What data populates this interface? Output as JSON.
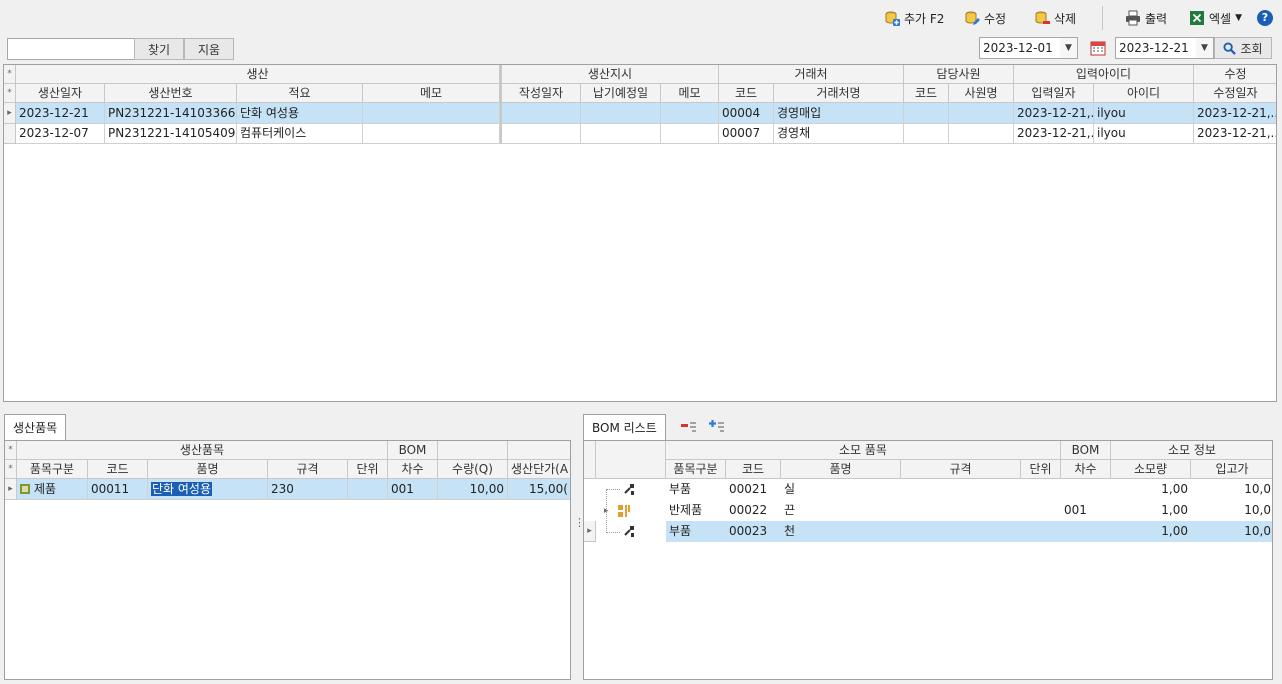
{
  "toolbar": {
    "add_label": "추가 F2",
    "edit_label": "수정",
    "delete_label": "삭제",
    "print_label": "출력",
    "excel_label": "엑셀",
    "help_icon": "?"
  },
  "search": {
    "input_value": "",
    "find_label": "찾기",
    "clear_label": "지움",
    "date_from": "2023-12-01",
    "date_to": "2023-12-21",
    "query_label": "조회"
  },
  "main_grid": {
    "groups": [
      "생산",
      "생산지시",
      "거래처",
      "담당사원",
      "입력아이디",
      "수정"
    ],
    "columns": [
      "생산일자",
      "생산번호",
      "적요",
      "메모",
      "작성일자",
      "납기예정일",
      "메모",
      "코드",
      "거래처명",
      "코드",
      "사원명",
      "입력일자",
      "아이디",
      "수정일자"
    ],
    "rows": [
      [
        "2023-12-21",
        "PN231221-14103366",
        "단화 여성용",
        "",
        "",
        "",
        "",
        "00004",
        "경영매입",
        "",
        "",
        "2023-12-21,...",
        "ilyou",
        "2023-12-21,..."
      ],
      [
        "2023-12-07",
        "PN231221-14105409",
        "컴퓨터케이스",
        "",
        "",
        "",
        "",
        "00007",
        "경영채",
        "",
        "",
        "2023-12-21,...",
        "ilyou",
        "2023-12-21,..."
      ]
    ]
  },
  "items_panel": {
    "tab_label": "생산품목",
    "groups": [
      "생산품목",
      "BOM"
    ],
    "columns": [
      "품목구분",
      "코드",
      "품명",
      "규격",
      "단위",
      "차수",
      "수량(Q)",
      "생산단가(A"
    ],
    "rows": [
      [
        "제품",
        "00011",
        "단화 여성용",
        "230",
        "",
        "001",
        "10,00",
        "15,00("
      ]
    ]
  },
  "bom_panel": {
    "tab_label": "BOM 리스트",
    "groups": [
      "소모 품목",
      "BOM",
      "소모 정보"
    ],
    "columns": [
      "품목구분",
      "코드",
      "품명",
      "규격",
      "단위",
      "차수",
      "소모량",
      "입고가"
    ],
    "rows": [
      [
        "부품",
        "00021",
        "실",
        "",
        "",
        "",
        "1,00",
        "10,0"
      ],
      [
        "반제품",
        "00022",
        "끈",
        "",
        "",
        "001",
        "1,00",
        "10,0"
      ],
      [
        "부품",
        "00023",
        "천",
        "",
        "",
        "",
        "1,00",
        "10,0"
      ]
    ]
  },
  "colors": {
    "selection": "#c6e2f7",
    "header": "#f3f3f3",
    "accent": "#1a5fb4"
  }
}
